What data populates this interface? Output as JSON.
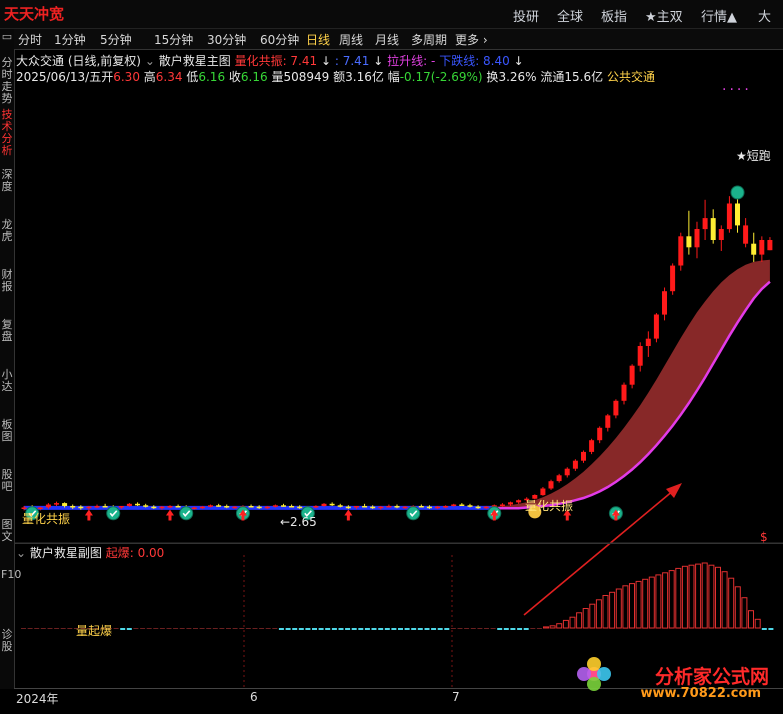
{
  "app": {
    "logo_text": "天天冲宽",
    "nav": [
      "投研",
      "全球",
      "板指",
      "★主双",
      "行情▲",
      "大"
    ]
  },
  "periods": {
    "tabs": [
      "分时",
      "1分钟",
      "5分钟",
      "15分钟",
      "30分钟",
      "60分钟",
      "日线",
      "周线",
      "月线",
      "多周期",
      "更多 ›"
    ],
    "active": "日线"
  },
  "sidebar": [
    "分时走势",
    "技术分析",
    "深度",
    "龙虎",
    "财报",
    "复盘",
    "小达",
    "板图",
    "股吧",
    "图文",
    "F10",
    "诊股"
  ],
  "main_header": {
    "stock": "大众交通 (日线,前复权)",
    "indicator": "散户救星主图",
    "quant_label": "量化共振: 7.41",
    "quant_value2": ": 7.41",
    "lift_label": "拉升线: -",
    "lift_label2": "下跌线: 8.40"
  },
  "quote": {
    "date": "2025/06/13/五",
    "open_label": "开",
    "open": "6.30",
    "high_label": "高",
    "high": "6.34",
    "low_label": "低",
    "low": "6.16",
    "close_label": "收",
    "close": "6.16",
    "vol_label": "量",
    "vol": "508949",
    "amt_label": "额",
    "amt": "3.16亿",
    "chg_label": "幅",
    "chg": "-0.17(-2.69%)",
    "turn_label": "换",
    "turn": "3.26%",
    "float_label": "流通",
    "float": "15.6亿",
    "name": "公共交通"
  },
  "annotations": {
    "quant_resonance": "量化共振",
    "quant_resonance_left": "量化共振",
    "short_run": "短跑",
    "price_marker": "←2.65",
    "dollar_right": "$",
    "volume_burst": "量起爆"
  },
  "sub_header": {
    "name": "散户救星副图",
    "burst_label": "起爆: 0.00"
  },
  "date_axis": [
    "2024年",
    "6",
    "7"
  ],
  "watermark": {
    "text": "分析家公式网",
    "url": "www.70822.com"
  },
  "chart_data": {
    "type": "candlestick",
    "title": "大众交通 (日线,前复权)",
    "last_bar": {
      "date": "2025/06/13",
      "open": 6.3,
      "high": 6.34,
      "low": 6.16,
      "close": 6.16,
      "volume": 508949
    },
    "candles": [
      [
        2.63,
        2.66,
        2.6,
        2.64
      ],
      [
        2.64,
        2.67,
        2.61,
        2.62
      ],
      [
        2.62,
        2.65,
        2.6,
        2.64
      ],
      [
        2.64,
        2.7,
        2.62,
        2.68
      ],
      [
        2.68,
        2.72,
        2.66,
        2.7
      ],
      [
        2.7,
        2.71,
        2.64,
        2.66
      ],
      [
        2.66,
        2.68,
        2.62,
        2.65
      ],
      [
        2.65,
        2.67,
        2.61,
        2.63
      ],
      [
        2.63,
        2.66,
        2.61,
        2.65
      ],
      [
        2.65,
        2.68,
        2.63,
        2.66
      ],
      [
        2.66,
        2.69,
        2.64,
        2.65
      ],
      [
        2.65,
        2.67,
        2.62,
        2.64
      ],
      [
        2.64,
        2.66,
        2.62,
        2.66
      ],
      [
        2.66,
        2.7,
        2.65,
        2.69
      ],
      [
        2.69,
        2.71,
        2.66,
        2.67
      ],
      [
        2.67,
        2.69,
        2.64,
        2.65
      ],
      [
        2.65,
        2.67,
        2.62,
        2.64
      ],
      [
        2.64,
        2.66,
        2.61,
        2.65
      ],
      [
        2.65,
        2.67,
        2.63,
        2.66
      ],
      [
        2.66,
        2.68,
        2.64,
        2.65
      ],
      [
        2.65,
        2.67,
        2.62,
        2.63
      ],
      [
        2.63,
        2.65,
        2.61,
        2.64
      ],
      [
        2.64,
        2.66,
        2.62,
        2.65
      ],
      [
        2.65,
        2.68,
        2.64,
        2.67
      ],
      [
        2.67,
        2.69,
        2.65,
        2.66
      ],
      [
        2.66,
        2.68,
        2.63,
        2.64
      ],
      [
        2.64,
        2.66,
        2.62,
        2.65
      ],
      [
        2.65,
        2.67,
        2.63,
        2.66
      ],
      [
        2.66,
        2.68,
        2.64,
        2.65
      ],
      [
        2.65,
        2.67,
        2.62,
        2.64
      ],
      [
        2.64,
        2.66,
        2.62,
        2.65
      ],
      [
        2.65,
        2.68,
        2.64,
        2.67
      ],
      [
        2.67,
        2.69,
        2.65,
        2.66
      ],
      [
        2.66,
        2.68,
        2.64,
        2.65
      ],
      [
        2.65,
        2.67,
        2.62,
        2.63
      ],
      [
        2.63,
        2.66,
        2.61,
        2.65
      ],
      [
        2.65,
        2.67,
        2.63,
        2.66
      ],
      [
        2.66,
        2.7,
        2.65,
        2.69
      ],
      [
        2.69,
        2.71,
        2.66,
        2.67
      ],
      [
        2.67,
        2.69,
        2.64,
        2.65
      ],
      [
        2.65,
        2.67,
        2.62,
        2.64
      ],
      [
        2.64,
        2.66,
        2.62,
        2.66
      ],
      [
        2.66,
        2.69,
        2.64,
        2.65
      ],
      [
        2.65,
        2.67,
        2.62,
        2.64
      ],
      [
        2.64,
        2.66,
        2.61,
        2.65
      ],
      [
        2.65,
        2.68,
        2.64,
        2.66
      ],
      [
        2.66,
        2.68,
        2.63,
        2.64
      ],
      [
        2.64,
        2.66,
        2.62,
        2.65
      ],
      [
        2.65,
        2.67,
        2.63,
        2.66
      ],
      [
        2.66,
        2.68,
        2.64,
        2.65
      ],
      [
        2.65,
        2.67,
        2.62,
        2.64
      ],
      [
        2.64,
        2.66,
        2.62,
        2.65
      ],
      [
        2.65,
        2.67,
        2.63,
        2.66
      ],
      [
        2.66,
        2.69,
        2.65,
        2.68
      ],
      [
        2.68,
        2.7,
        2.66,
        2.67
      ],
      [
        2.67,
        2.69,
        2.64,
        2.65
      ],
      [
        2.65,
        2.67,
        2.62,
        2.64
      ],
      [
        2.64,
        2.66,
        2.62,
        2.65
      ],
      [
        2.65,
        2.68,
        2.64,
        2.67
      ],
      [
        2.67,
        2.7,
        2.65,
        2.68
      ],
      [
        2.68,
        2.72,
        2.66,
        2.71
      ],
      [
        2.71,
        2.75,
        2.69,
        2.74
      ],
      [
        2.74,
        2.78,
        2.72,
        2.76
      ],
      [
        2.76,
        2.82,
        2.75,
        2.81
      ],
      [
        2.81,
        2.92,
        2.8,
        2.9
      ],
      [
        2.9,
        3.02,
        2.88,
        3.0
      ],
      [
        3.0,
        3.1,
        2.98,
        3.08
      ],
      [
        3.08,
        3.19,
        3.05,
        3.17
      ],
      [
        3.17,
        3.3,
        3.14,
        3.28
      ],
      [
        3.28,
        3.42,
        3.25,
        3.4
      ],
      [
        3.4,
        3.58,
        3.37,
        3.56
      ],
      [
        3.56,
        3.75,
        3.52,
        3.73
      ],
      [
        3.73,
        3.92,
        3.68,
        3.9
      ],
      [
        3.9,
        4.12,
        3.86,
        4.1
      ],
      [
        4.1,
        4.35,
        4.05,
        4.32
      ],
      [
        4.32,
        4.6,
        4.27,
        4.58
      ],
      [
        4.58,
        4.9,
        4.5,
        4.85
      ],
      [
        4.85,
        5.05,
        4.7,
        4.95
      ],
      [
        4.95,
        5.3,
        4.9,
        5.28
      ],
      [
        5.28,
        5.65,
        5.2,
        5.6
      ],
      [
        5.6,
        5.98,
        5.55,
        5.95
      ],
      [
        5.95,
        6.4,
        5.88,
        6.35
      ],
      [
        6.35,
        6.7,
        6.1,
        6.2
      ],
      [
        6.2,
        6.55,
        6.05,
        6.45
      ],
      [
        6.45,
        6.85,
        6.3,
        6.6
      ],
      [
        6.6,
        6.72,
        6.25,
        6.3
      ],
      [
        6.3,
        6.5,
        6.15,
        6.45
      ],
      [
        6.45,
        6.9,
        6.4,
        6.8
      ],
      [
        6.8,
        6.95,
        6.4,
        6.5
      ],
      [
        6.5,
        6.6,
        6.2,
        6.25
      ],
      [
        6.25,
        6.4,
        6.0,
        6.1
      ],
      [
        6.1,
        6.35,
        6.0,
        6.3
      ],
      [
        6.3,
        6.34,
        6.16,
        6.16
      ]
    ],
    "band_upper": [
      2.64,
      2.64,
      2.64,
      2.64,
      2.64,
      2.64,
      2.64,
      2.64,
      2.64,
      2.64,
      2.64,
      2.64,
      2.64,
      2.64,
      2.64,
      2.64,
      2.64,
      2.64,
      2.64,
      2.64,
      2.64,
      2.64,
      2.64,
      2.64,
      2.64,
      2.64,
      2.64,
      2.64,
      2.64,
      2.64,
      2.64,
      2.64,
      2.64,
      2.64,
      2.64,
      2.64,
      2.64,
      2.64,
      2.64,
      2.64,
      2.64,
      2.64,
      2.64,
      2.64,
      2.64,
      2.64,
      2.64,
      2.64,
      2.64,
      2.64,
      2.64,
      2.64,
      2.64,
      2.64,
      2.64,
      2.64,
      2.64,
      2.64,
      2.65,
      2.66,
      2.67,
      2.69,
      2.71,
      2.74,
      2.78,
      2.83,
      2.89,
      2.96,
      3.04,
      3.13,
      3.23,
      3.34,
      3.46,
      3.59,
      3.73,
      3.88,
      4.04,
      4.21,
      4.39,
      4.58,
      4.77,
      4.96,
      5.14,
      5.31,
      5.46,
      5.6,
      5.72,
      5.82,
      5.9,
      5.96,
      6.0,
      6.02,
      6.03
    ],
    "band_lower": [
      2.63,
      2.63,
      2.63,
      2.63,
      2.63,
      2.63,
      2.63,
      2.63,
      2.63,
      2.63,
      2.63,
      2.63,
      2.63,
      2.63,
      2.63,
      2.63,
      2.63,
      2.63,
      2.63,
      2.63,
      2.63,
      2.63,
      2.63,
      2.63,
      2.63,
      2.63,
      2.63,
      2.63,
      2.63,
      2.63,
      2.63,
      2.63,
      2.63,
      2.63,
      2.63,
      2.63,
      2.63,
      2.63,
      2.63,
      2.63,
      2.63,
      2.63,
      2.63,
      2.63,
      2.63,
      2.63,
      2.63,
      2.63,
      2.63,
      2.63,
      2.63,
      2.63,
      2.63,
      2.63,
      2.63,
      2.63,
      2.63,
      2.63,
      2.63,
      2.63,
      2.63,
      2.63,
      2.64,
      2.65,
      2.66,
      2.67,
      2.69,
      2.71,
      2.74,
      2.77,
      2.81,
      2.86,
      2.92,
      2.99,
      3.07,
      3.16,
      3.26,
      3.37,
      3.49,
      3.62,
      3.76,
      3.91,
      4.07,
      4.24,
      4.42,
      4.61,
      4.8,
      4.99,
      5.17,
      5.34,
      5.5,
      5.63,
      5.73
    ],
    "sub_values": [
      0,
      0,
      0,
      0,
      0,
      0,
      0,
      0,
      0,
      0,
      0,
      0,
      0,
      0,
      0,
      -1,
      -1,
      0,
      0,
      0,
      0,
      0,
      0,
      0,
      0,
      0,
      0,
      0,
      0,
      0,
      0,
      0,
      0,
      0,
      0,
      0,
      0,
      0,
      0,
      -1,
      -1,
      -1,
      -1,
      -1,
      -1,
      -1,
      -1,
      -1,
      -1,
      -1,
      -1,
      -1,
      -1,
      -1,
      -1,
      -1,
      -1,
      -1,
      -1,
      -1,
      -1,
      -1,
      -1,
      -1,
      -1,
      0,
      0,
      0,
      0,
      0,
      0,
      0,
      -1,
      -1,
      -1,
      -1,
      -1,
      0,
      0,
      1,
      2,
      4,
      7,
      10,
      14,
      18,
      22,
      26,
      30,
      33,
      36,
      39,
      41,
      43,
      45,
      47,
      49,
      51,
      53,
      55,
      57,
      58,
      59,
      60,
      58,
      56,
      52,
      46,
      38,
      28,
      16,
      8,
      -2,
      -4
    ],
    "ylim": [
      2.4,
      7.6
    ]
  }
}
